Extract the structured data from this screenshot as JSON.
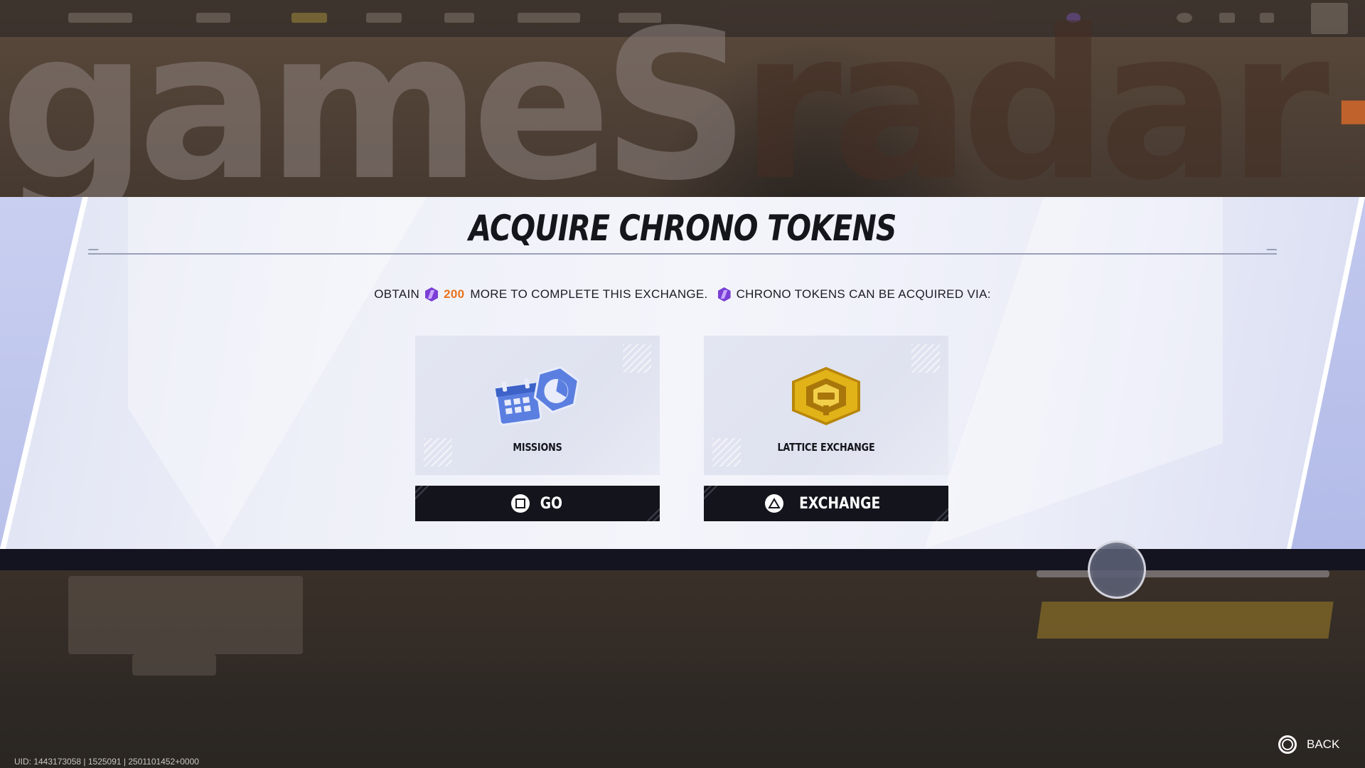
{
  "dialog": {
    "title": "ACQUIRE CHRONO TOKENS",
    "info_prefix": "OBTAIN",
    "info_amount": "200",
    "info_middle": "MORE TO COMPLETE THIS EXCHANGE.",
    "info_suffix": "CHRONO TOKENS CAN BE ACQUIRED VIA:"
  },
  "options": [
    {
      "label": "MISSIONS",
      "button": "GO",
      "button_icon": "square-button-icon"
    },
    {
      "label": "LATTICE EXCHANGE",
      "button": "EXCHANGE",
      "button_icon": "triangle-button-icon"
    }
  ],
  "footer": {
    "uid": "UID: 1443173058 | 1525091 | 2501101452+0000",
    "back_label": "BACK"
  },
  "watermark": "gamesradar+",
  "colors": {
    "amount": "#e9731e",
    "token": "#7a3fd6",
    "button_bg": "#14151c",
    "lattice_gold": "#e2b318",
    "missions_blue": "#5b7fe0"
  }
}
